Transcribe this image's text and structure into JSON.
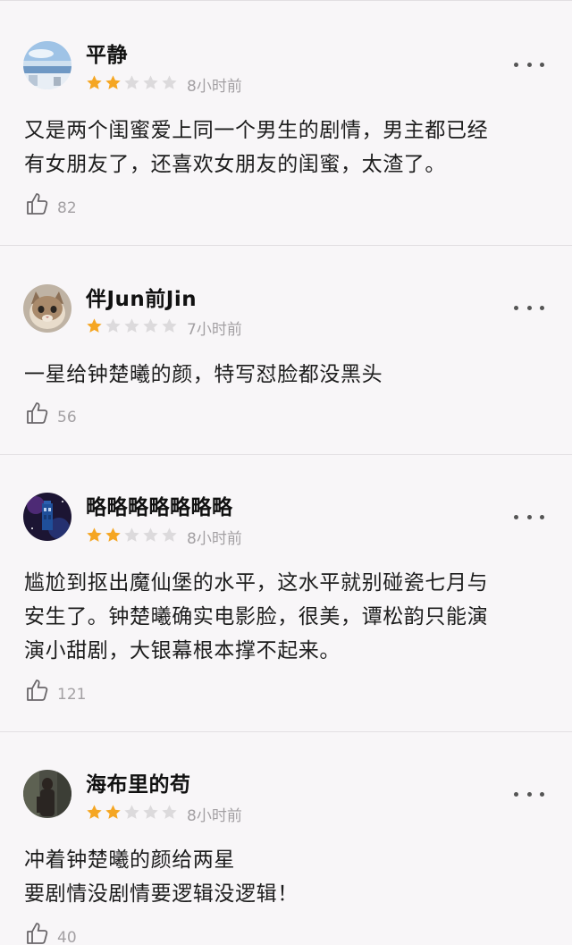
{
  "reviews": [
    {
      "username": "平静",
      "rating": 2,
      "max_rating": 5,
      "time": "8小时前",
      "content_lines": [
        "又是两个闺蜜爱上同一个男生的剧情，男主都已经",
        "有女朋友了，还喜欢女朋友的闺蜜，太渣了。"
      ],
      "likes": "82"
    },
    {
      "username": "伴Jun前Jin",
      "rating": 1,
      "max_rating": 5,
      "time": "7小时前",
      "content_lines": [
        "一星给钟楚曦的颜，特写怼脸都没黑头"
      ],
      "likes": "56"
    },
    {
      "username": "略略略略略略略",
      "rating": 2,
      "max_rating": 5,
      "time": "8小时前",
      "content_lines": [
        "尴尬到抠出魔仙堡的水平，这水平就别碰瓷七月与",
        "安生了。钟楚曦确实电影脸，很美，谭松韵只能演",
        "演小甜剧，大银幕根本撑不起来。"
      ],
      "likes": "121"
    },
    {
      "username": "海布里的苟",
      "rating": 2,
      "max_rating": 5,
      "time": "8小时前",
      "content_lines": [
        "冲着钟楚曦的颜给两星",
        "要剧情没剧情要逻辑没逻辑！"
      ],
      "likes": "40"
    }
  ],
  "colors": {
    "star_filled": "#f5a623",
    "star_empty": "#dcdadc"
  },
  "icons": {
    "more": "more-dots-icon",
    "like": "thumbs-up-icon"
  }
}
